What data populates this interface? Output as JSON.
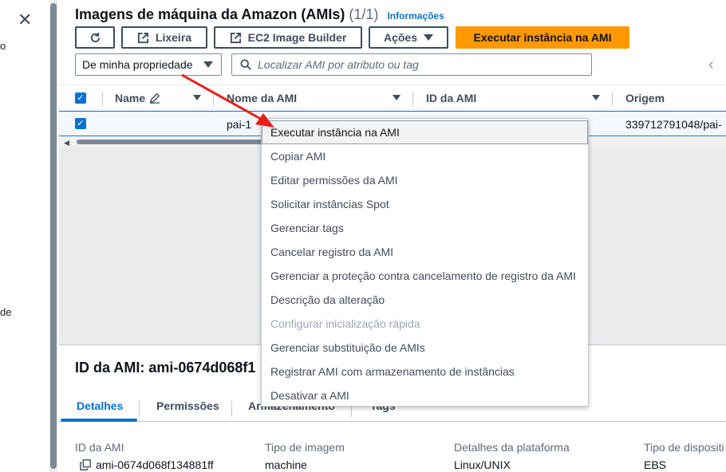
{
  "left_nav": {
    "frag_top": "o",
    "frag_bottom": "de"
  },
  "header": {
    "title": "Imagens de máquina da Amazon (AMIs)",
    "count": "(1/1)",
    "info_link": "Informações"
  },
  "toolbar": {
    "refresh_icon": "refresh-icon",
    "recycle_label": "Lixeira",
    "builder_label": "EC2 Image Builder",
    "actions_label": "Ações",
    "launch_label": "Executar instância na AMI",
    "accent": "#ff9900"
  },
  "filter": {
    "ownership_value": "De minha propriedade",
    "search_placeholder": "Localizar AMI por atributo ou tag"
  },
  "table": {
    "columns": [
      "Name",
      "Nome da AMI",
      "ID da AMI",
      "Origem"
    ],
    "rows": [
      {
        "name": "",
        "ami_name": "pai-1",
        "ami_id": "",
        "origin": "339712791048/pai-"
      }
    ]
  },
  "actions_menu": {
    "items": [
      {
        "label": "Executar instância na AMI",
        "state": "hover"
      },
      {
        "label": "Copiar AMI",
        "state": "normal"
      },
      {
        "label": "Editar permissões da AMI",
        "state": "normal"
      },
      {
        "label": "Solicitar instâncias Spot",
        "state": "normal"
      },
      {
        "label": "Gerenciar tags",
        "state": "normal"
      },
      {
        "label": "Cancelar registro da AMI",
        "state": "normal"
      },
      {
        "label": "Gerenciar a proteção contra cancelamento de registro da AMI",
        "state": "normal"
      },
      {
        "label": "Descrição da alteração",
        "state": "normal"
      },
      {
        "label": "Configurar inicialização rápida",
        "state": "disabled"
      },
      {
        "label": "Gerenciar substituição de AMIs",
        "state": "normal"
      },
      {
        "label": "Registrar AMI com armazenamento de instâncias",
        "state": "normal"
      },
      {
        "label": "Desativar a AMI",
        "state": "normal"
      }
    ]
  },
  "details": {
    "title": "ID da AMI: ami-0674d068f1",
    "tabs": [
      "Detalhes",
      "Permissões",
      "Armazenamento",
      "Tags"
    ],
    "fields": [
      {
        "label": "ID da AMI",
        "value": "ami-0674d068f134881ff"
      },
      {
        "label": "Tipo de imagem",
        "value": "machine"
      },
      {
        "label": "Detalhes da plataforma",
        "value": "Linux/UNIX"
      },
      {
        "label": "Tipo de dispositi",
        "value": "EBS"
      }
    ]
  },
  "annotation": {
    "arrow_color": "#e8201a"
  }
}
